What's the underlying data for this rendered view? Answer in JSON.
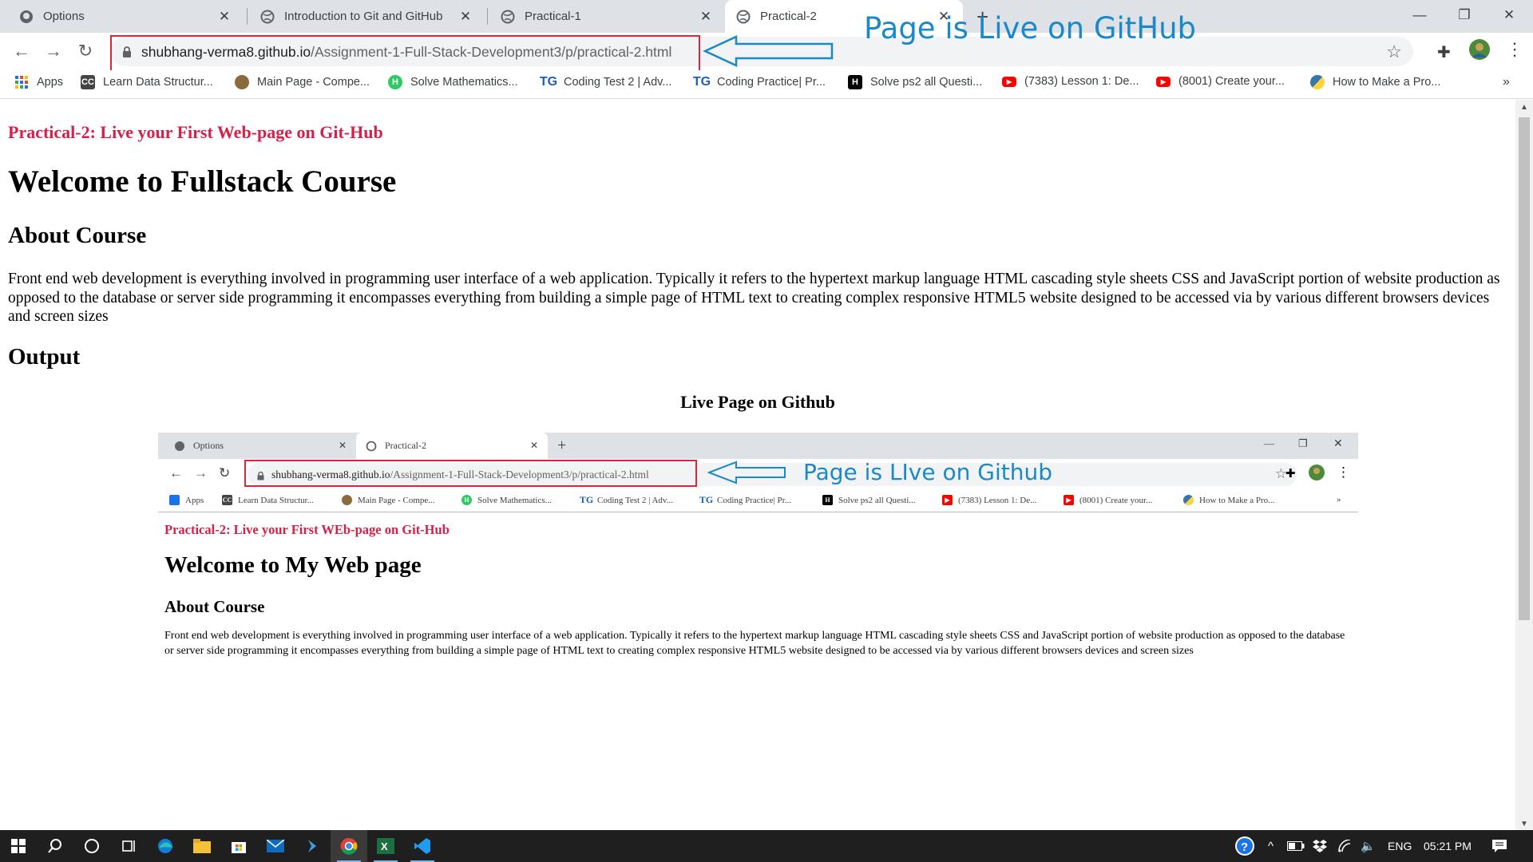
{
  "browser": {
    "tabs": [
      {
        "label": "Options"
      },
      {
        "label": "Introduction to Git and GitHub"
      },
      {
        "label": "Practical-1"
      },
      {
        "label": "Practical-2"
      }
    ],
    "active_tab": 3,
    "url_domain": "shubhang-verma8.github.io",
    "url_path": "/Assignment-1-Full-Stack-Development3/p/practical-2.html",
    "bookmarks": [
      {
        "label": "Apps"
      },
      {
        "label": "Learn Data Structur..."
      },
      {
        "label": "Main Page - Compe..."
      },
      {
        "label": "Solve Mathematics..."
      },
      {
        "label": "Coding Test 2 | Adv..."
      },
      {
        "label": "Coding Practice| Pr..."
      },
      {
        "label": "Solve ps2 all Questi..."
      },
      {
        "label": "(7383) Lesson 1: De..."
      },
      {
        "label": "(8001) Create your..."
      },
      {
        "label": "How to Make a Pro..."
      }
    ],
    "bookmarks_more": "»"
  },
  "annotation": {
    "text": "Page is Live on GitHub"
  },
  "page": {
    "subtitle": "Practical-2: Live your First Web-page on Git-Hub",
    "title": "Welcome to Fullstack Course",
    "about_heading": "About Course",
    "about_text": "Front end web development is everything involved in programming user interface of a web application. Typically it refers to the hypertext markup language HTML cascading style sheets CSS and JavaScript portion of website production as opposed to the database or server side programming it encompasses everything from building a simple page of HTML text to creating complex responsive HTML5 website designed to be accessed via by various different browsers devices and screen sizes",
    "output_heading": "Output",
    "figure_caption": "Live Page on Github"
  },
  "embedded": {
    "tabs": [
      {
        "label": "Options"
      },
      {
        "label": "Practical-2"
      }
    ],
    "url_domain": "shubhang-verma8.github.io",
    "url_path": "/Assignment-1-Full-Stack-Development3/p/practical-2.html",
    "annotation": "Page is LIve on Github",
    "bookmarks": [
      {
        "label": "Apps"
      },
      {
        "label": "Learn Data Structur..."
      },
      {
        "label": "Main Page - Compe..."
      },
      {
        "label": "Solve Mathematics..."
      },
      {
        "label": "Coding Test 2 | Adv..."
      },
      {
        "label": "Coding Practice| Pr..."
      },
      {
        "label": "Solve ps2 all Questi..."
      },
      {
        "label": "(7383) Lesson 1: De..."
      },
      {
        "label": "(8001) Create your..."
      },
      {
        "label": "How to Make a Pro..."
      }
    ],
    "subtitle": "Practical-2: Live your First WEb-page on Git-Hub",
    "title": "Welcome to My Web page",
    "about_heading": "About Course",
    "about_text": "Front end web development is everything involved in programming user interface of a web application. Typically it refers to the hypertext markup language HTML cascading style sheets CSS and JavaScript portion of website production as opposed to the database or server side programming it encompasses everything from building a simple page of HTML text to creating complex responsive HTML5 website designed to be accessed via by various different browsers devices and screen sizes"
  },
  "taskbar": {
    "language": "ENG",
    "time": "05:21 PM"
  },
  "colors": {
    "accent_red": "#d6204a",
    "annotation_blue": "#1a89c9",
    "highlight_box": "#d8263a"
  }
}
